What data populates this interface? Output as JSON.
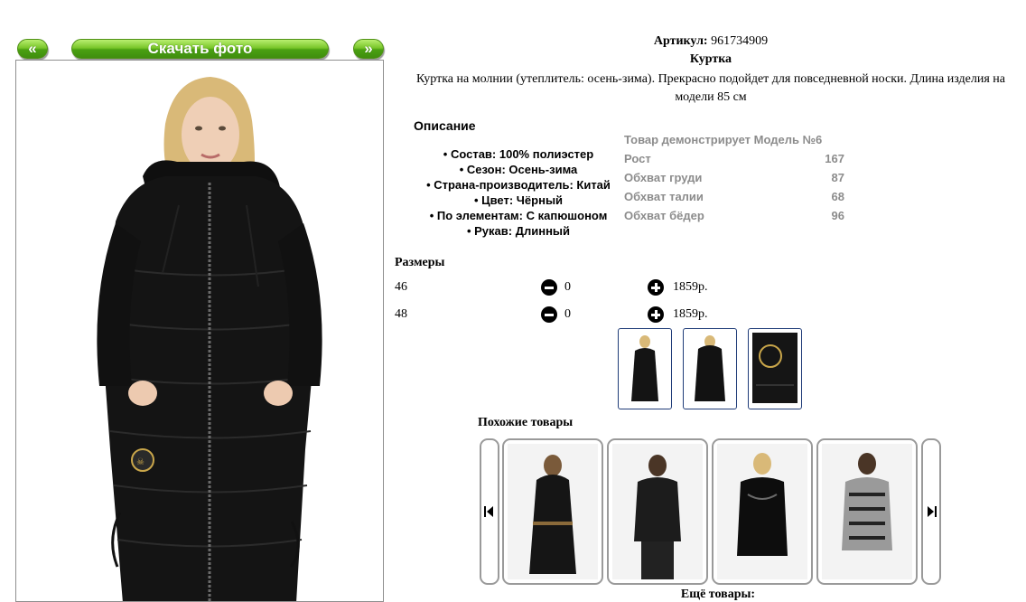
{
  "gallery": {
    "prev_label": "«",
    "download_label": "Скачать фото",
    "next_label": "»"
  },
  "product": {
    "sku_label": "Артикул:",
    "sku_value": "961734909",
    "name": "Куртка",
    "description": "Куртка на молнии (утеплитель: осень-зима). Прекрасно подойдет для повседневной носки. Длина изделия на модели 85 см"
  },
  "specs": {
    "heading": "Описание",
    "items": [
      "• Состав: 100% полиэстер",
      "• Сезон: Осень-зима",
      "• Страна-производитель: Китай",
      "• Цвет: Чёрный",
      "• По элементам: С капюшоном",
      "• Рукав: Длинный"
    ]
  },
  "model": {
    "heading": "Товар демонстрирует Модель №6",
    "rows": [
      {
        "label": "Рост",
        "value": "167"
      },
      {
        "label": "Обхват груди",
        "value": "87"
      },
      {
        "label": "Обхват талии",
        "value": "68"
      },
      {
        "label": "Обхват бёдер",
        "value": "96"
      }
    ]
  },
  "sizes": {
    "heading": "Размеры",
    "rows": [
      {
        "size": "46",
        "qty": "0",
        "price": "1859р."
      },
      {
        "size": "48",
        "qty": "0",
        "price": "1859р."
      }
    ]
  },
  "similar": {
    "heading": "Похожие товары",
    "more_label": "Ещё товары:"
  },
  "colors": {
    "button_green": "#79c62a",
    "thumb_border": "#1f3c78",
    "muted_text": "#8c8c8c"
  }
}
